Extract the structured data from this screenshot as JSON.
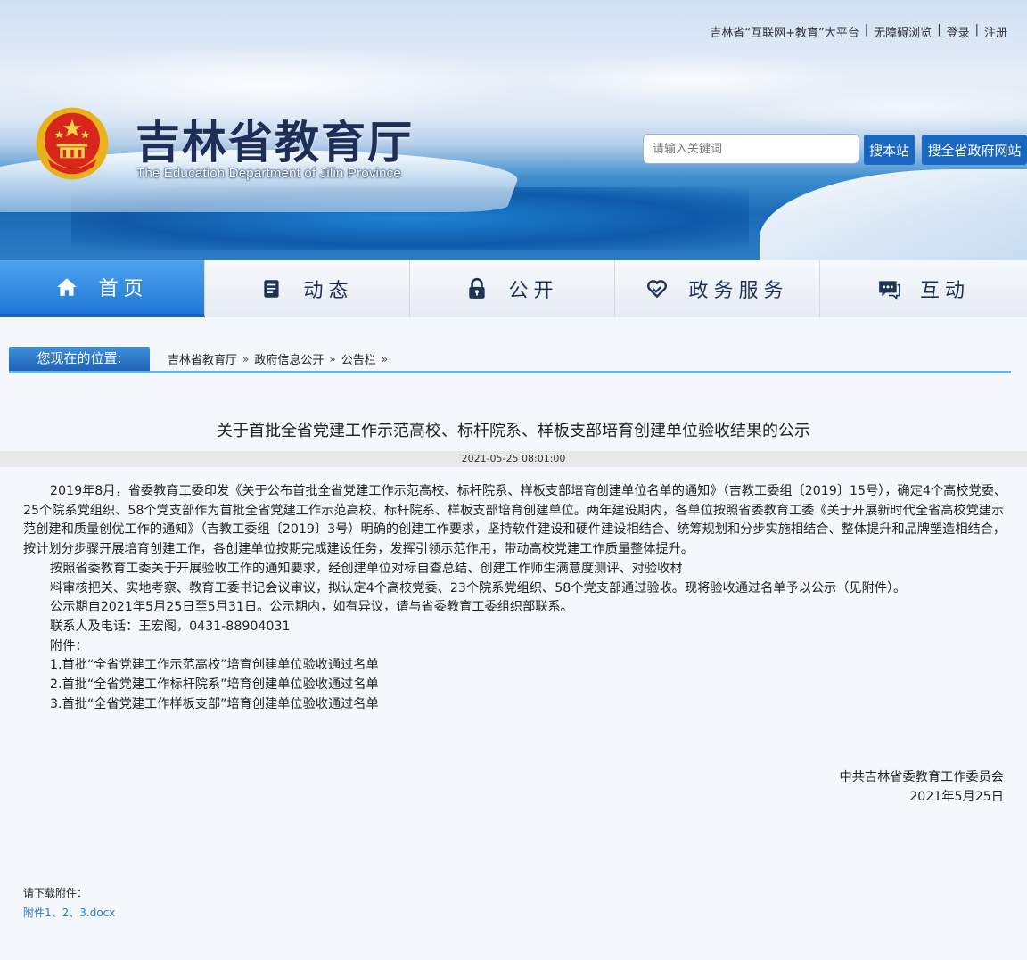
{
  "header": {
    "top_links": [
      "吉林省“互联网+教育”大平台",
      "无障碍浏览",
      "登录",
      "注册"
    ],
    "top_separator": "|",
    "site_title": "吉林省教育厅",
    "site_subtitle": "The Education Department of Jilin Province",
    "search": {
      "placeholder": "请输入关键词",
      "btn_site": "搜本站",
      "btn_gov": "搜全省政府网站"
    }
  },
  "nav": {
    "items": [
      {
        "label": "首页",
        "icon": "home-icon",
        "active": true
      },
      {
        "label": "动态",
        "icon": "document-icon",
        "active": false
      },
      {
        "label": "公开",
        "icon": "lock-icon",
        "active": false
      },
      {
        "label": "政务服务",
        "icon": "heart-hands-icon",
        "active": false
      },
      {
        "label": "互动",
        "icon": "chat-icon",
        "active": false
      }
    ]
  },
  "breadcrumb": {
    "label": "您现在的位置:",
    "items": [
      "吉林省教育厅",
      "政府信息公开",
      "公告栏"
    ],
    "arrow": "»"
  },
  "article": {
    "title": "关于首批全省党建工作示范高校、标杆院系、样板支部培育创建单位验收结果的公示",
    "date": "2021-05-25 08:01:00",
    "paragraph1": "2019年8月，省委教育工委印发《关于公布首批全省党建工作示范高校、标杆院系、样板支部培育创建单位名单的通知》（吉教工委组〔2019〕15号），确定4个高校党委、25个院系党组织、58个党支部作为首批全省党建工作示范高校、标杆院系、样板支部培育创建单位。两年建设期内，各单位按照省委教育工委《关于开展新时代全省高校党建示范创建和质量创优工作的通知》（吉教工委组〔2019〕3号）明确的创建工作要求，坚持软件建设和硬件建设相结合、统筹规划和分步实施相结合、整体提升和品牌塑造相结合，按计划分步骤开展培育创建工作，各创建单位按期完成建设任务，发挥引领示范作用，带动高校党建工作质量整体提升。",
    "paragraph2_line1": "按照省委教育工委关于开展验收工作的通知要求，经创建单位对标自查总结、创建工作师生满意度测评、对验收材",
    "paragraph2_line2": "料审核把关、实地考察、教育工委书记会议审议，拟认定4个高校党委、23个院系党组织、58个党支部通过验收。现将验收通过名单予以公示（见附件）。",
    "paragraph3": "公示期自2021年5月25日至5月31日。公示期内，如有异议，请与省委教育工委组织部联系。",
    "contact": "联系人及电话：王宏阁，0431-88904031",
    "attachments_label": "附件：",
    "attachments": [
      "1.首批“全省党建工作示范高校”培育创建单位验收通过名单",
      "2.首批“全省党建工作标杆院系”培育创建单位验收通过名单",
      "3.首批“全省党建工作样板支部”培育创建单位验收通过名单"
    ],
    "signature_org": "中共吉林省委教育工作委员会",
    "signature_date": "2021年5月25日"
  },
  "download": {
    "label": "请下载附件：",
    "link": "附件1、2、3.docx"
  },
  "colors": {
    "nav_active": "#1f78d6",
    "search_button": "#1a67c2",
    "link": "#2a7fd0",
    "title_text": "#1d2f57"
  }
}
